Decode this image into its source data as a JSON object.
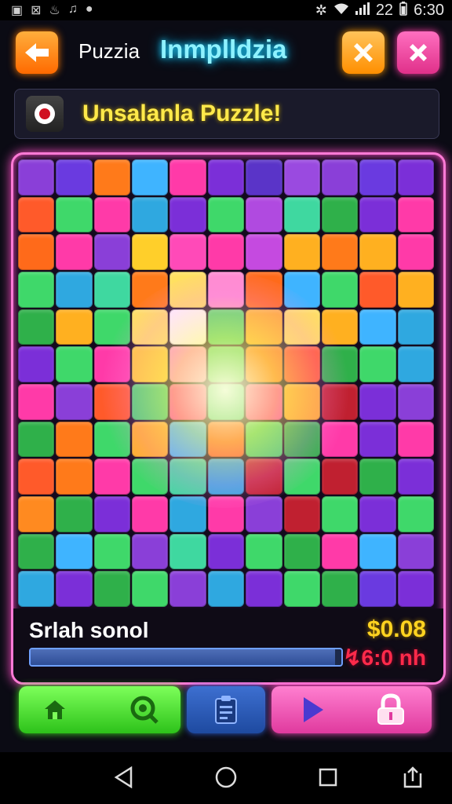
{
  "status_bar": {
    "signal": "22",
    "time": "6:30"
  },
  "header": {
    "app_name": "Puzzia",
    "title": "Inmplldzia"
  },
  "banner": {
    "text": "Unsalanla Puzzle!"
  },
  "board": {
    "status_label": "Srlah sonol",
    "price": "$0.08",
    "rate": "↯6:0 nh",
    "progress": 0.98,
    "pieces": [
      "#8a3fd8",
      "#6a3ae0",
      "#ff7a1a",
      "#3fb4ff",
      "#ff3aa8",
      "#7b2fd8",
      "#5a34c8",
      "#9a4ae0",
      "#8a3fd8",
      "#6a3ae0",
      "#7b2fd8",
      "#ff5a2a",
      "#3fd86a",
      "#ff3aa8",
      "#2fa8e0",
      "#7b2fd8",
      "#3fd86a",
      "#b04ae0",
      "#3fd8a0",
      "#2fb04a",
      "#7b2fd8",
      "#ff3aa8",
      "#ff6a1a",
      "#ff3aa8",
      "#8a3fd8",
      "#ffcf2a",
      "#ff4ab8",
      "#ff3aa8",
      "#c54ae0",
      "#ffb020",
      "#ff7a1a",
      "#ffb020",
      "#ff3aa8",
      "#3fd86a",
      "#2fa8e0",
      "#3fd8a0",
      "#ff7a1a",
      "#ffe060",
      "#ff8ad0",
      "#ff6a1a",
      "#3fb4ff",
      "#3fd86a",
      "#ff5a2a",
      "#ffb020",
      "#2fb04a",
      "#ffb020",
      "#3fd86a",
      "#ffe060",
      "#ffffff",
      "#3fd86a",
      "#ffb020",
      "#ffe060",
      "#ffb020",
      "#3fb4ff",
      "#2fa8e0",
      "#7b2fd8",
      "#3fd86a",
      "#ff3aa8",
      "#ffcf2a",
      "#ff8ad0",
      "#3fd86a",
      "#ff7a1a",
      "#ff5a2a",
      "#2fb04a",
      "#3fd86a",
      "#2fa8e0",
      "#ff3aa8",
      "#8a3fd8",
      "#ff5a2a",
      "#3fd86a",
      "#ff3aa8",
      "#3fd8a0",
      "#ff3aa8",
      "#ffb020",
      "#c02030",
      "#7b2fd8",
      "#8a3fd8",
      "#2fb04a",
      "#ff7a1a",
      "#3fd86a",
      "#ffb020",
      "#3fb4ff",
      "#ff5a2a",
      "#3fd86a",
      "#2fb04a",
      "#ff3aa8",
      "#7b2fd8",
      "#ff3aa8",
      "#ff5a2a",
      "#ff7a1a",
      "#ff3aa8",
      "#3fd86a",
      "#3fd8a0",
      "#2fa8e0",
      "#c02030",
      "#3fd86a",
      "#c02030",
      "#2fb04a",
      "#7b2fd8",
      "#ff8a20",
      "#2fb04a",
      "#7b2fd8",
      "#ff3aa8",
      "#2fa8e0",
      "#ff3aa8",
      "#8a3fd8",
      "#c02030",
      "#3fd86a",
      "#7b2fd8",
      "#3fd86a",
      "#2fb04a",
      "#3fb4ff",
      "#3fd86a",
      "#8a3fd8",
      "#3fd8a0",
      "#7b2fd8",
      "#3fd86a",
      "#2fb04a",
      "#ff3aa8",
      "#3fb4ff",
      "#8a3fd8",
      "#2fa8e0",
      "#7b2fd8",
      "#2fb04a",
      "#3fd86a",
      "#8a3fd8",
      "#2fa8e0",
      "#7b2fd8",
      "#3fd86a",
      "#2fb04a",
      "#6a3ae0",
      "#7b2fd8"
    ]
  },
  "controls": {
    "home": "home-icon",
    "zoom": "zoom-icon",
    "clipboard": "clipboard-icon",
    "play": "play-icon",
    "lock": "lock-icon"
  },
  "colors": {
    "accent_pink": "#ff4fc8",
    "title_cyan": "#22d8ff",
    "banner_yellow": "#ffe94a",
    "price_gold": "#ffd320",
    "rate_red": "#ff2a4a"
  }
}
